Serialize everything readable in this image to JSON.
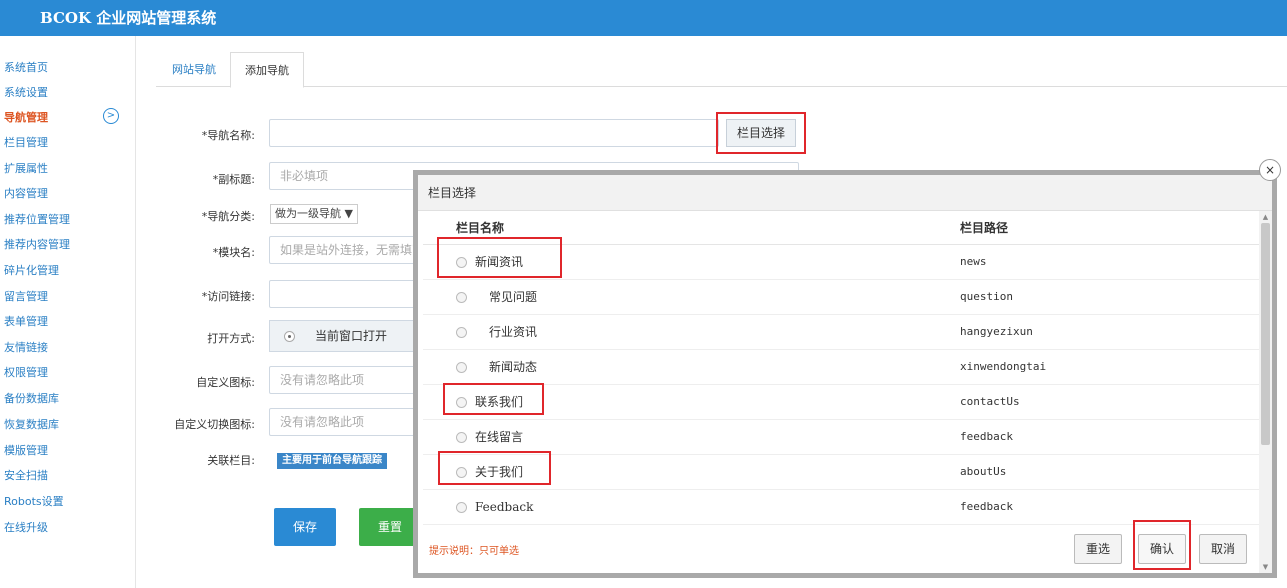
{
  "app": {
    "title": "BCOK 企业网站管理系统"
  },
  "sidebar": {
    "items": [
      {
        "label": "系统首页"
      },
      {
        "label": "系统设置"
      },
      {
        "label": "导航管理"
      },
      {
        "label": "栏目管理"
      },
      {
        "label": "扩展属性"
      },
      {
        "label": "内容管理"
      },
      {
        "label": "推荐位置管理"
      },
      {
        "label": "推荐内容管理"
      },
      {
        "label": "碎片化管理"
      },
      {
        "label": "留言管理"
      },
      {
        "label": "表单管理"
      },
      {
        "label": "友情链接"
      },
      {
        "label": "权限管理"
      },
      {
        "label": "备份数据库"
      },
      {
        "label": "恢复数据库"
      },
      {
        "label": "模版管理"
      },
      {
        "label": "安全扫描"
      },
      {
        "label": "Robots设置"
      },
      {
        "label": "在线升级"
      }
    ],
    "arrow_icon": "chevron-right-circle-icon"
  },
  "tabs": [
    {
      "label": "网站导航"
    },
    {
      "label": "添加导航"
    }
  ],
  "form": {
    "nav_name_label": "*导航名称:",
    "select_column_button": "栏目选择",
    "subtitle_label": "*副标题:",
    "subtitle_placeholder": "非必填项",
    "category_label": "*导航分类:",
    "category_value": "做为一级导航 ▼",
    "module_label": "*模块名:",
    "module_placeholder": "如果是站外连接，无需填写",
    "link_label": "*访问链接:",
    "open_label": "打开方式:",
    "open_value": "当前窗口打开",
    "icon_label": "自定义图标:",
    "icon_placeholder": "没有请忽略此项",
    "switch_icon_label": "自定义切换图标:",
    "switch_icon_placeholder": "没有请忽略此项",
    "related_label": "关联栏目:",
    "related_badge": "主要用于前台导航跟踪",
    "save_button": "保存",
    "reset_button": "重置"
  },
  "modal": {
    "title": "栏目选择",
    "col_name": "栏目名称",
    "col_path": "栏目路径",
    "rows": [
      {
        "name": "新闻资讯",
        "path": "news"
      },
      {
        "name": "常见问题",
        "path": "question"
      },
      {
        "name": "行业资讯",
        "path": "hangyezixun"
      },
      {
        "name": "新闻动态",
        "path": "xinwendongtai"
      },
      {
        "name": "联系我们",
        "path": "contactUs"
      },
      {
        "name": "在线留言",
        "path": "feedback"
      },
      {
        "name": "关于我们",
        "path": "aboutUs"
      },
      {
        "name": "Feedback",
        "path": "feedback"
      }
    ],
    "hint": "提示说明：只可单选",
    "reselect_button": "重选",
    "confirm_button": "确认",
    "cancel_button": "取消",
    "close_glyph": "×"
  },
  "colors": {
    "topbar": "#2a8ad4",
    "highlight": "#e0262b",
    "save": "#2a8ad4",
    "reset": "#3cae49"
  }
}
